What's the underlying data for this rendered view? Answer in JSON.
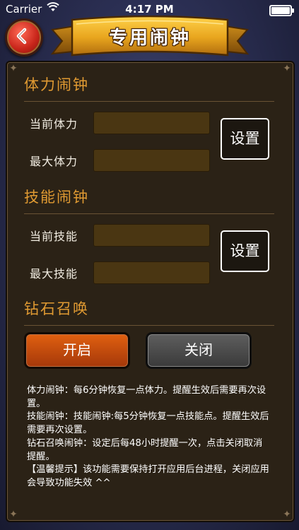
{
  "status_bar": {
    "carrier": "Carrier",
    "time": "4:17 PM"
  },
  "header": {
    "title": "专用闹钟",
    "back_icon": "back-arrow-icon"
  },
  "stamina": {
    "title": "体力闹钟",
    "current_label": "当前体力",
    "current_value": "",
    "max_label": "最大体力",
    "max_value": "",
    "set_label": "设置"
  },
  "skill": {
    "title": "技能闹钟",
    "current_label": "当前技能",
    "current_value": "",
    "max_label": "最大技能",
    "max_value": "",
    "set_label": "设置"
  },
  "diamond": {
    "title": "钻石召唤",
    "on_label": "开启",
    "off_label": "关闭"
  },
  "description": [
    "体力闹钟：每6分钟恢复一点体力。提醒生效后需要再次设置。",
    "技能闹钟：技能闹钟:每5分钟恢复一点技能点。提醒生效后需要再次设置。",
    "钻石召唤闹钟：设定后每48小时提醒一次，点击关闭取消提醒。",
    "【温馨提示】该功能需要保持打开应用后台进程，关闭应用会导致功能失效 ^^"
  ],
  "colors": {
    "accent": "#e09a32",
    "on_button": "#c8480c",
    "off_button": "#4a4a4a",
    "input_bg": "#4a3612"
  }
}
